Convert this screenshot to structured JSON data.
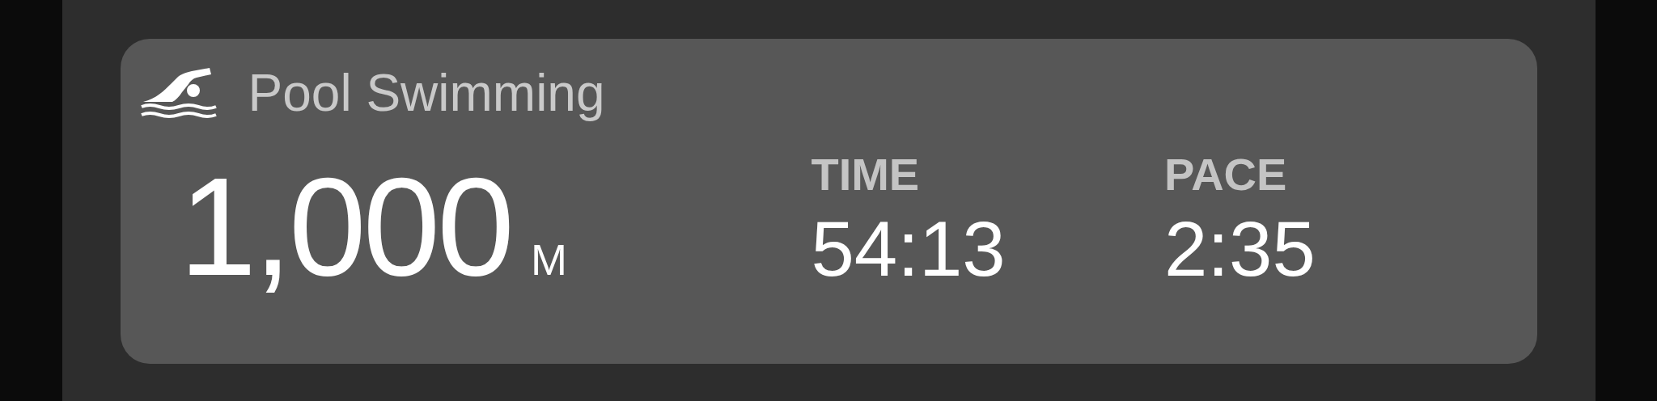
{
  "workout": {
    "title": "Pool Swimming",
    "distance": {
      "value": "1,000",
      "unit": "M"
    },
    "stats": [
      {
        "label": "TIME",
        "value": "54:13"
      },
      {
        "label": "PACE",
        "value": "2:35"
      }
    ]
  }
}
